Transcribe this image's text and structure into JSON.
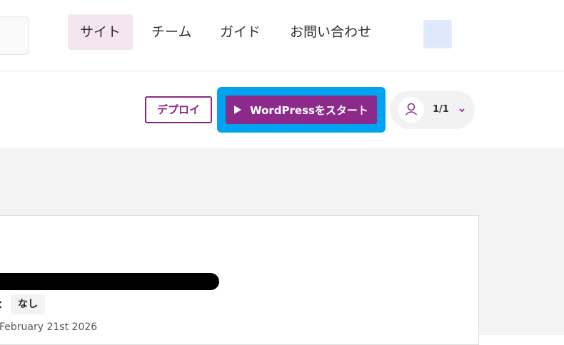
{
  "nav": {
    "items": [
      {
        "label": "サイト",
        "active": true
      },
      {
        "label": "チーム",
        "active": false
      },
      {
        "label": "ガイド",
        "active": false
      },
      {
        "label": "お問い合わせ",
        "active": false
      }
    ]
  },
  "toolbar": {
    "deploy_label": "デプロイ",
    "start_label": "WordPressをスタート",
    "user_count": "1/1"
  },
  "site_card": {
    "status_label": "態：",
    "status_value": "なし",
    "date": "February 21st 2026"
  },
  "colors": {
    "brand_purple": "#8b2a8a",
    "focus_blue": "#00a3ef",
    "nav_active_bg": "#f3e6f1"
  },
  "icons": [
    "play-icon",
    "user-icon",
    "chevron-down-icon",
    "calendar-icon"
  ]
}
